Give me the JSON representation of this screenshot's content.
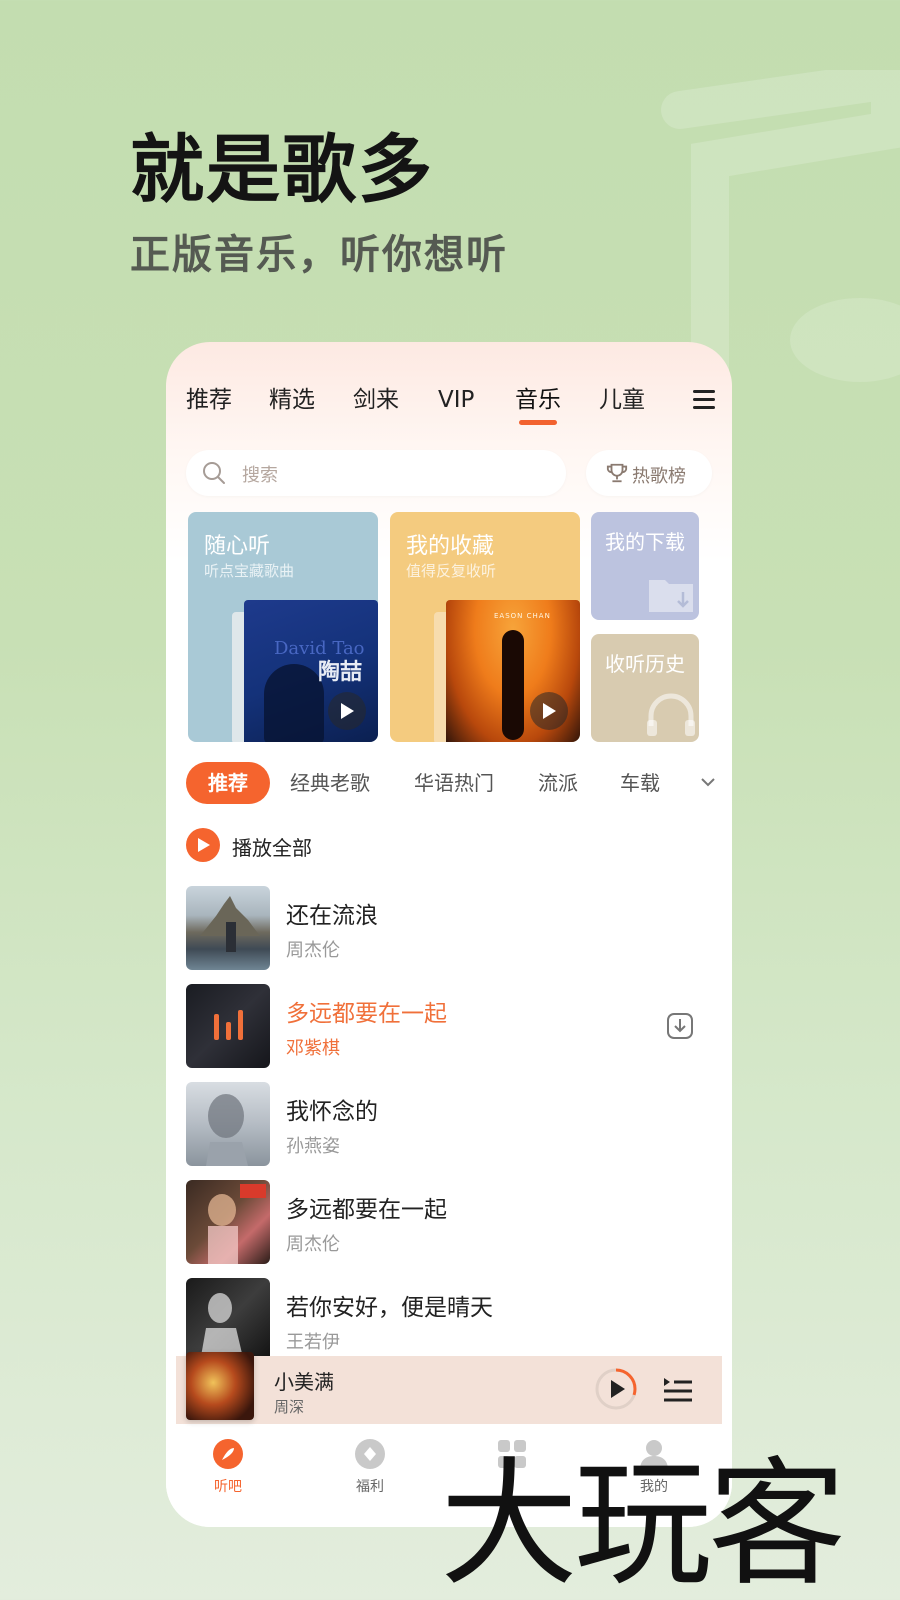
{
  "hero": {
    "title": "就是歌多",
    "subtitle": "正版音乐，听你想听"
  },
  "tabs": [
    {
      "label": "推荐"
    },
    {
      "label": "精选"
    },
    {
      "label": "剑来"
    },
    {
      "label": "VIP"
    },
    {
      "label": "音乐",
      "active": true
    },
    {
      "label": "儿童"
    }
  ],
  "search": {
    "placeholder": "搜索",
    "hot_label": "热歌榜"
  },
  "cards": {
    "random": {
      "title": "随心听",
      "subtitle": "听点宝藏歌曲",
      "cover_text_1": "David Tao",
      "cover_text_2": "陶喆"
    },
    "favorites": {
      "title": "我的收藏",
      "subtitle": "值得反复收听",
      "cover_text": "EASON CHAN"
    },
    "downloads": {
      "title": "我的下载"
    },
    "history": {
      "title": "收听历史"
    }
  },
  "chips": [
    {
      "label": "推荐",
      "active": true
    },
    {
      "label": "经典老歌"
    },
    {
      "label": "华语热门"
    },
    {
      "label": "流派"
    },
    {
      "label": "车载"
    }
  ],
  "play_all": "播放全部",
  "songs": [
    {
      "title": "还在流浪",
      "artist": "周杰伦"
    },
    {
      "title": "多远都要在一起",
      "artist": "邓紫棋",
      "playing": true
    },
    {
      "title": "我怀念的",
      "artist": "孙燕姿"
    },
    {
      "title": "多远都要在一起",
      "artist": "周杰伦"
    },
    {
      "title": "若你安好，便是晴天",
      "artist": "王若伊"
    }
  ],
  "mini_player": {
    "title": "小美满",
    "artist": "周深",
    "progress": 0.3
  },
  "bottom_nav": [
    {
      "label": "听吧",
      "active": true
    },
    {
      "label": "福利"
    },
    {
      "label": ""
    },
    {
      "label": "我的"
    }
  ],
  "watermark": "大玩客",
  "colors": {
    "accent": "#f5642e",
    "background": "#c8e0b5",
    "playing_text": "#f0703a"
  }
}
